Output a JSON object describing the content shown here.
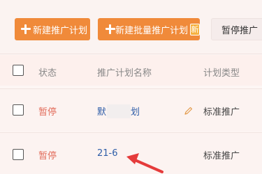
{
  "toolbar": {
    "new_plan_label": "新建推广计划",
    "new_batch_plan_label": "新建批量推广计划",
    "new_badge": "新",
    "pause_label": "暂停推广"
  },
  "table": {
    "headers": {
      "status": "状态",
      "plan_name": "推广计划名称",
      "plan_type": "计划类型"
    },
    "rows": [
      {
        "status": "暂停",
        "name_prefix": "默",
        "name_suffix": "划",
        "type": "标准推广"
      },
      {
        "status": "暂停",
        "name": "21-6",
        "type": "标准推广"
      }
    ]
  },
  "colors": {
    "accent": "#f08a3a",
    "status_paused": "#e26d5c",
    "link": "#2f5ea8",
    "annotation_arrow": "#e53b3b"
  },
  "icons": [
    "plus-icon",
    "pencil-icon",
    "red-arrow-annotation"
  ]
}
